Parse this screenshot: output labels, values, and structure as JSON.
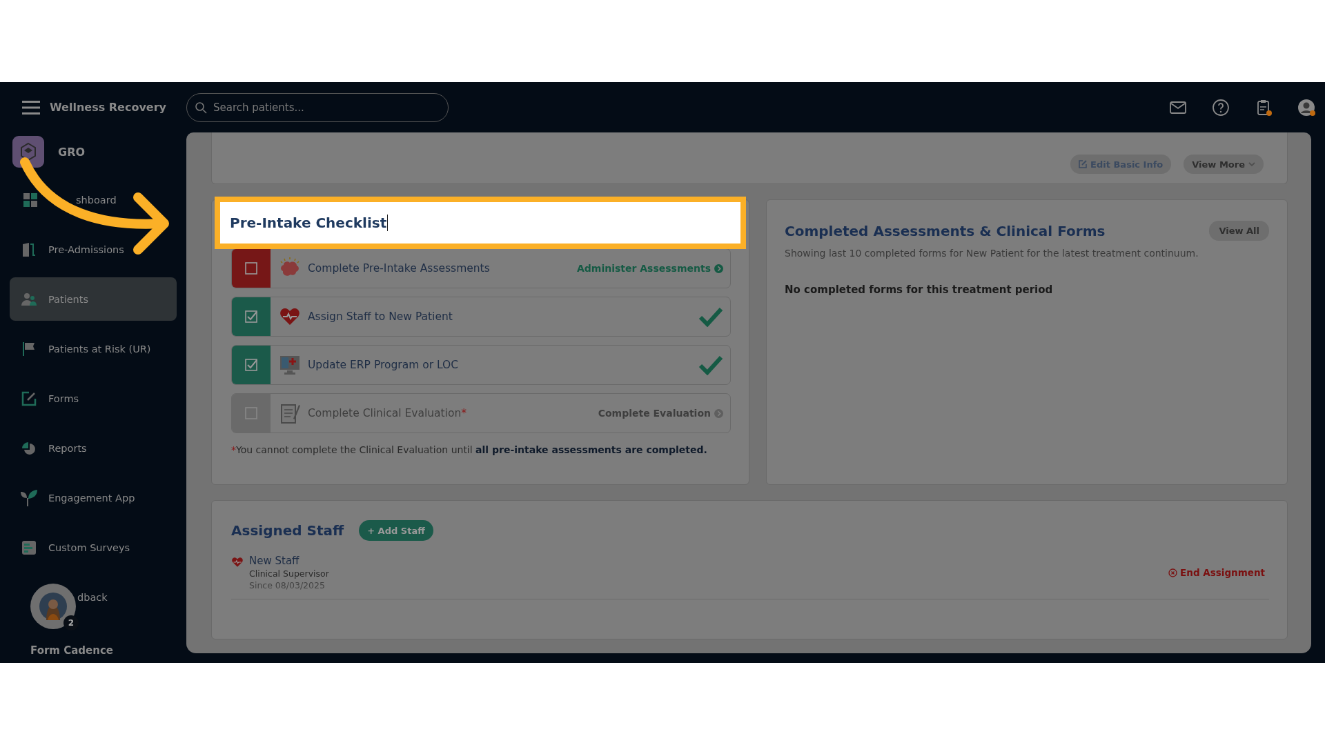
{
  "header": {
    "brand": "Wellness Recovery",
    "search": {
      "placeholder": "Search patients..."
    }
  },
  "sidebar": {
    "org": "GRO",
    "items": [
      {
        "label": "shboard",
        "selected": false
      },
      {
        "label": "Pre-Admissions",
        "selected": false
      },
      {
        "label": "Patients",
        "selected": true
      },
      {
        "label": "Patients at Risk (UR)",
        "selected": false
      },
      {
        "label": "Forms",
        "selected": false
      },
      {
        "label": "Reports",
        "selected": false
      },
      {
        "label": "Engagement App",
        "selected": false
      },
      {
        "label": "Custom Surveys",
        "selected": false
      },
      {
        "label": "dback",
        "selected": false
      }
    ],
    "widget": {
      "badge": "2",
      "label": "Form Cadence"
    }
  },
  "patient_card": {
    "buttons": [
      {
        "label": "Edit Basic Info",
        "kind": "edit"
      },
      {
        "label": "View More",
        "kind": "more"
      }
    ]
  },
  "checklist": {
    "title": "Pre-Intake Checklist",
    "items": [
      {
        "kind": "todo",
        "checked": false,
        "label": "Complete Pre-Intake Assessments",
        "action": "Administer Assessments"
      },
      {
        "kind": "done",
        "checked": true,
        "label": "Assign Staff to New Patient"
      },
      {
        "kind": "done",
        "checked": true,
        "label": "Update ERP Program or LOC"
      },
      {
        "kind": "locked",
        "checked": false,
        "label": "Complete Clinical Evaluation",
        "required_mark": "*",
        "action": "Complete Evaluation"
      }
    ],
    "footnote_mark": "*",
    "footnote": "You cannot complete the Clinical Evaluation until **all pre-intake assessments are completed.**"
  },
  "completed_forms": {
    "title": "Completed Assessments & Clinical Forms",
    "view_all": "View All",
    "subtitle": "Showing last 10 completed forms for New Patient for the latest treatment continuum.",
    "empty": "No completed forms for this treatment period"
  },
  "assigned_staff": {
    "title": "Assigned Staff",
    "add": "+ Add Staff",
    "staff": [
      {
        "name": "New Staff",
        "role": "Clinical Supervisor",
        "since": "Since 08/03/2025",
        "action": "End Assignment"
      }
    ]
  }
}
